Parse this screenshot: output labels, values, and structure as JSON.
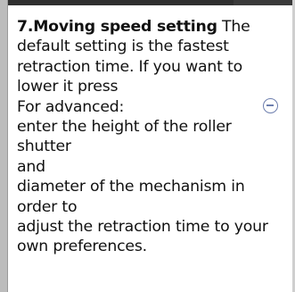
{
  "step": {
    "heading": "7.Moving speed setting",
    "body": " The default setting is the fastest retraction time. If you want to lower it press",
    "advanced_label": "For advanced:",
    "lines": [
      "enter the height of the roller shutter",
      "and",
      "diameter of the mechanism in order to",
      "adjust the retraction time to your own preferences."
    ]
  },
  "icons": {
    "collapse": "minus-circle-icon"
  },
  "colors": {
    "text": "#111111",
    "icon": "#6e7fae",
    "frame": "#2f2f2f"
  }
}
